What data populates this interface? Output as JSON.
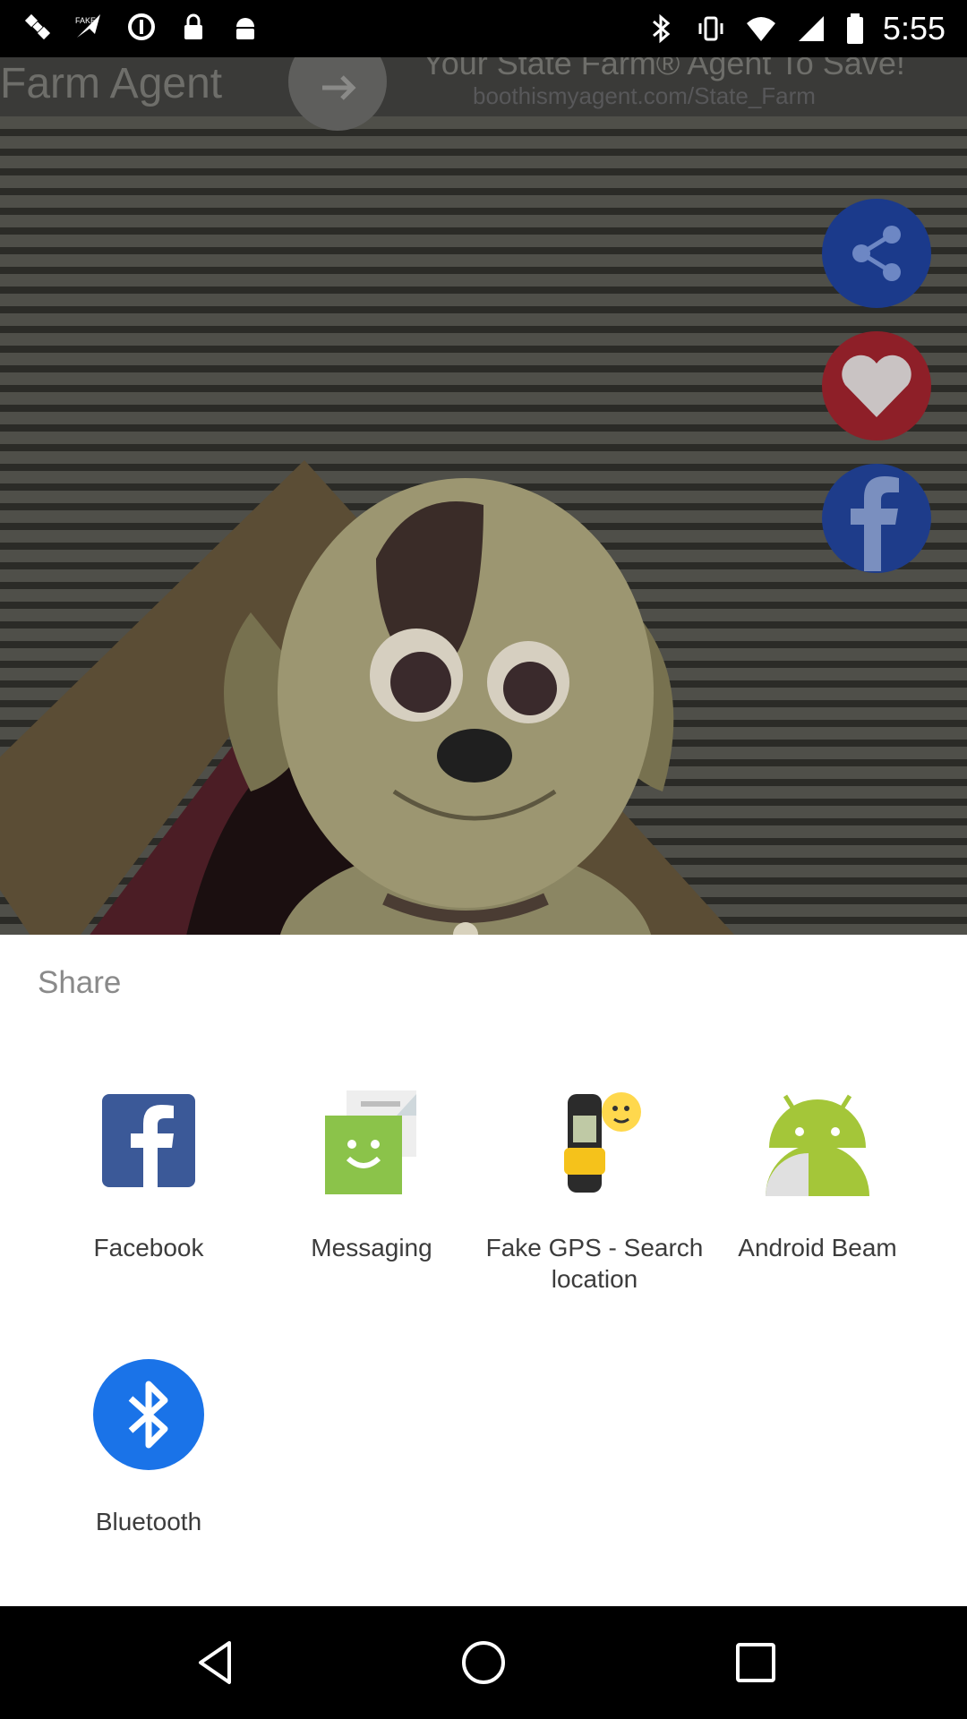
{
  "status_bar": {
    "time": "5:55",
    "left_icons": [
      "satellite-icon",
      "fake-gps-icon",
      "data-saver-icon",
      "lock-icon",
      "android-icon"
    ],
    "right_icons": [
      "bluetooth-icon",
      "vibrate-icon",
      "wifi-icon",
      "signal-icon",
      "battery-icon"
    ]
  },
  "ad": {
    "left_text": "Farm Agent",
    "headline": "Your State Farm® Agent To Save!",
    "url": "boothismyagent.com/State_Farm"
  },
  "side_buttons": [
    "share-icon",
    "heart-icon",
    "facebook-icon"
  ],
  "share_sheet": {
    "title": "Share",
    "apps": [
      {
        "label": "Facebook",
        "icon": "facebook-icon"
      },
      {
        "label": "Messaging",
        "icon": "messaging-icon"
      },
      {
        "label": "Fake GPS - Search location",
        "icon": "fake-gps-icon"
      },
      {
        "label": "Android Beam",
        "icon": "android-beam-icon"
      },
      {
        "label": "Bluetooth",
        "icon": "bluetooth-icon"
      }
    ]
  },
  "nav_bar": [
    "back-icon",
    "home-icon",
    "recents-icon"
  ],
  "colors": {
    "facebook_blue": "#3b5998",
    "messaging_green": "#8bc34a",
    "android_green": "#a4c639",
    "bluetooth_blue": "#1a73e8"
  }
}
